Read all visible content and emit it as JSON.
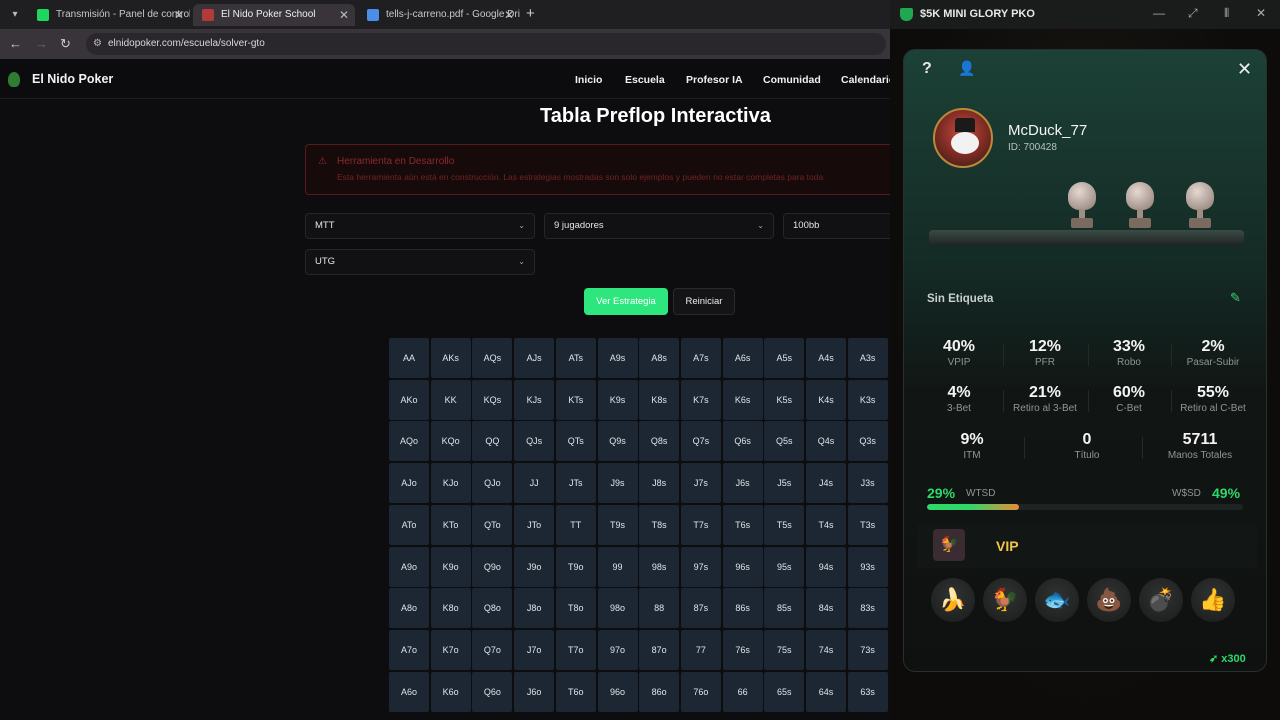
{
  "browser": {
    "tabs": [
      {
        "label": "Transmisión - Panel de control",
        "favicon_color": "#1ed760",
        "active": false
      },
      {
        "label": "El Nido Poker School",
        "favicon_color": "#b33a3a",
        "active": true
      },
      {
        "label": "tells-j-carreno.pdf - Google Dri",
        "favicon_color": "#4a8ee8",
        "active": false
      }
    ],
    "url": "elnidopoker.com/escuela/solver-gto"
  },
  "site": {
    "brand": "El Nido Poker",
    "nav": [
      "Inicio",
      "Escuela",
      "Profesor IA",
      "Comunidad",
      "Calendario"
    ],
    "page_title": "Tabla Preflop Interactiva",
    "alert": {
      "title": "Herramienta en Desarrollo",
      "text": "Esta herramienta aún está en construcción. Las estrategias mostradas son solo ejemplos y pueden no estar completas para toda"
    },
    "selects": {
      "format": "MTT",
      "players": "9 jugadores",
      "stack": "100bb",
      "position": "UTG"
    },
    "buttons": {
      "primary": "Ver Estrategia",
      "secondary": "Reiniciar"
    },
    "hand_grid": [
      [
        "AA",
        "AKs",
        "AQs",
        "AJs",
        "ATs",
        "A9s",
        "A8s",
        "A7s",
        "A6s",
        "A5s",
        "A4s",
        "A3s"
      ],
      [
        "AKo",
        "KK",
        "KQs",
        "KJs",
        "KTs",
        "K9s",
        "K8s",
        "K7s",
        "K6s",
        "K5s",
        "K4s",
        "K3s"
      ],
      [
        "AQo",
        "KQo",
        "QQ",
        "QJs",
        "QTs",
        "Q9s",
        "Q8s",
        "Q7s",
        "Q6s",
        "Q5s",
        "Q4s",
        "Q3s"
      ],
      [
        "AJo",
        "KJo",
        "QJo",
        "JJ",
        "JTs",
        "J9s",
        "J8s",
        "J7s",
        "J6s",
        "J5s",
        "J4s",
        "J3s"
      ],
      [
        "ATo",
        "KTo",
        "QTo",
        "JTo",
        "TT",
        "T9s",
        "T8s",
        "T7s",
        "T6s",
        "T5s",
        "T4s",
        "T3s"
      ],
      [
        "A9o",
        "K9o",
        "Q9o",
        "J9o",
        "T9o",
        "99",
        "98s",
        "97s",
        "96s",
        "95s",
        "94s",
        "93s"
      ],
      [
        "A8o",
        "K8o",
        "Q8o",
        "J8o",
        "T8o",
        "98o",
        "88",
        "87s",
        "86s",
        "85s",
        "84s",
        "83s"
      ],
      [
        "A7o",
        "K7o",
        "Q7o",
        "J7o",
        "T7o",
        "97o",
        "87o",
        "77",
        "76s",
        "75s",
        "74s",
        "73s"
      ],
      [
        "A6o",
        "K6o",
        "Q6o",
        "J6o",
        "T6o",
        "96o",
        "86o",
        "76o",
        "66",
        "65s",
        "64s",
        "63s"
      ]
    ]
  },
  "poker": {
    "window_title": "$5K MINI GLORY PKO",
    "player": {
      "name": "McDuck_77",
      "id": "ID: 700428"
    },
    "tag_label": "Sin Etiqueta",
    "stats": [
      {
        "value": "40%",
        "label": "VPIP"
      },
      {
        "value": "12%",
        "label": "PFR"
      },
      {
        "value": "33%",
        "label": "Robo"
      },
      {
        "value": "2%",
        "label": "Pasar-Subir"
      },
      {
        "value": "4%",
        "label": "3-Bet"
      },
      {
        "value": "21%",
        "label": "Retiro al 3-Bet"
      },
      {
        "value": "60%",
        "label": "C-Bet"
      },
      {
        "value": "55%",
        "label": "Retiro al C-Bet"
      },
      {
        "value": "9%",
        "label": "ITM"
      },
      {
        "value": "0",
        "label": "Título"
      },
      {
        "value": "5711",
        "label": "Manos Totales"
      }
    ],
    "wtsd": {
      "value": "29%",
      "label": "WTSD",
      "fraction": 0.29
    },
    "wsd": {
      "value": "49%",
      "label": "W$SD"
    },
    "vip_label": "VIP",
    "emojis": [
      "banana",
      "rooster",
      "fish",
      "poop",
      "bomb",
      "thumbs-up"
    ],
    "multiplier": "x300",
    "accent_green": "#2ed86a"
  }
}
